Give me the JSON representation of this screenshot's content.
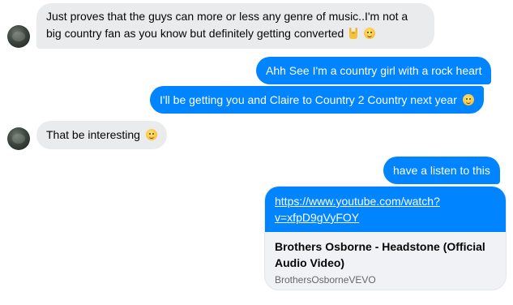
{
  "messages": [
    {
      "id": "m1",
      "direction": "in",
      "text": "Just proves that the guys can more or less any genre of music..I'm not a big country fan as you know but definitely getting converted"
    },
    {
      "id": "m2",
      "direction": "out",
      "text": "Ahh See I'm a country girl with a rock heart"
    },
    {
      "id": "m3",
      "direction": "out",
      "text": "I'll be getting you and Claire to Country 2 Country next year"
    },
    {
      "id": "m4",
      "direction": "in",
      "text": "That be interesting"
    },
    {
      "id": "m5",
      "direction": "out",
      "text": "have a listen to this"
    }
  ],
  "link_preview": {
    "url_line1": "https://www.youtube.com/watch?",
    "url_line2": "v=xfpD9gVyFOY",
    "title": "Brothers Osborne - Headstone (Official Audio Video)",
    "source": "BrothersOsborneVEVO"
  },
  "icons": {
    "smile": "smiling-face-emoji",
    "rock": "sign-of-the-horns-emoji",
    "avatar": "contact-avatar"
  },
  "colors": {
    "outgoing_bubble": "#0084ff",
    "incoming_bubble": "#e9ebed",
    "link_text": "#ffffff"
  }
}
